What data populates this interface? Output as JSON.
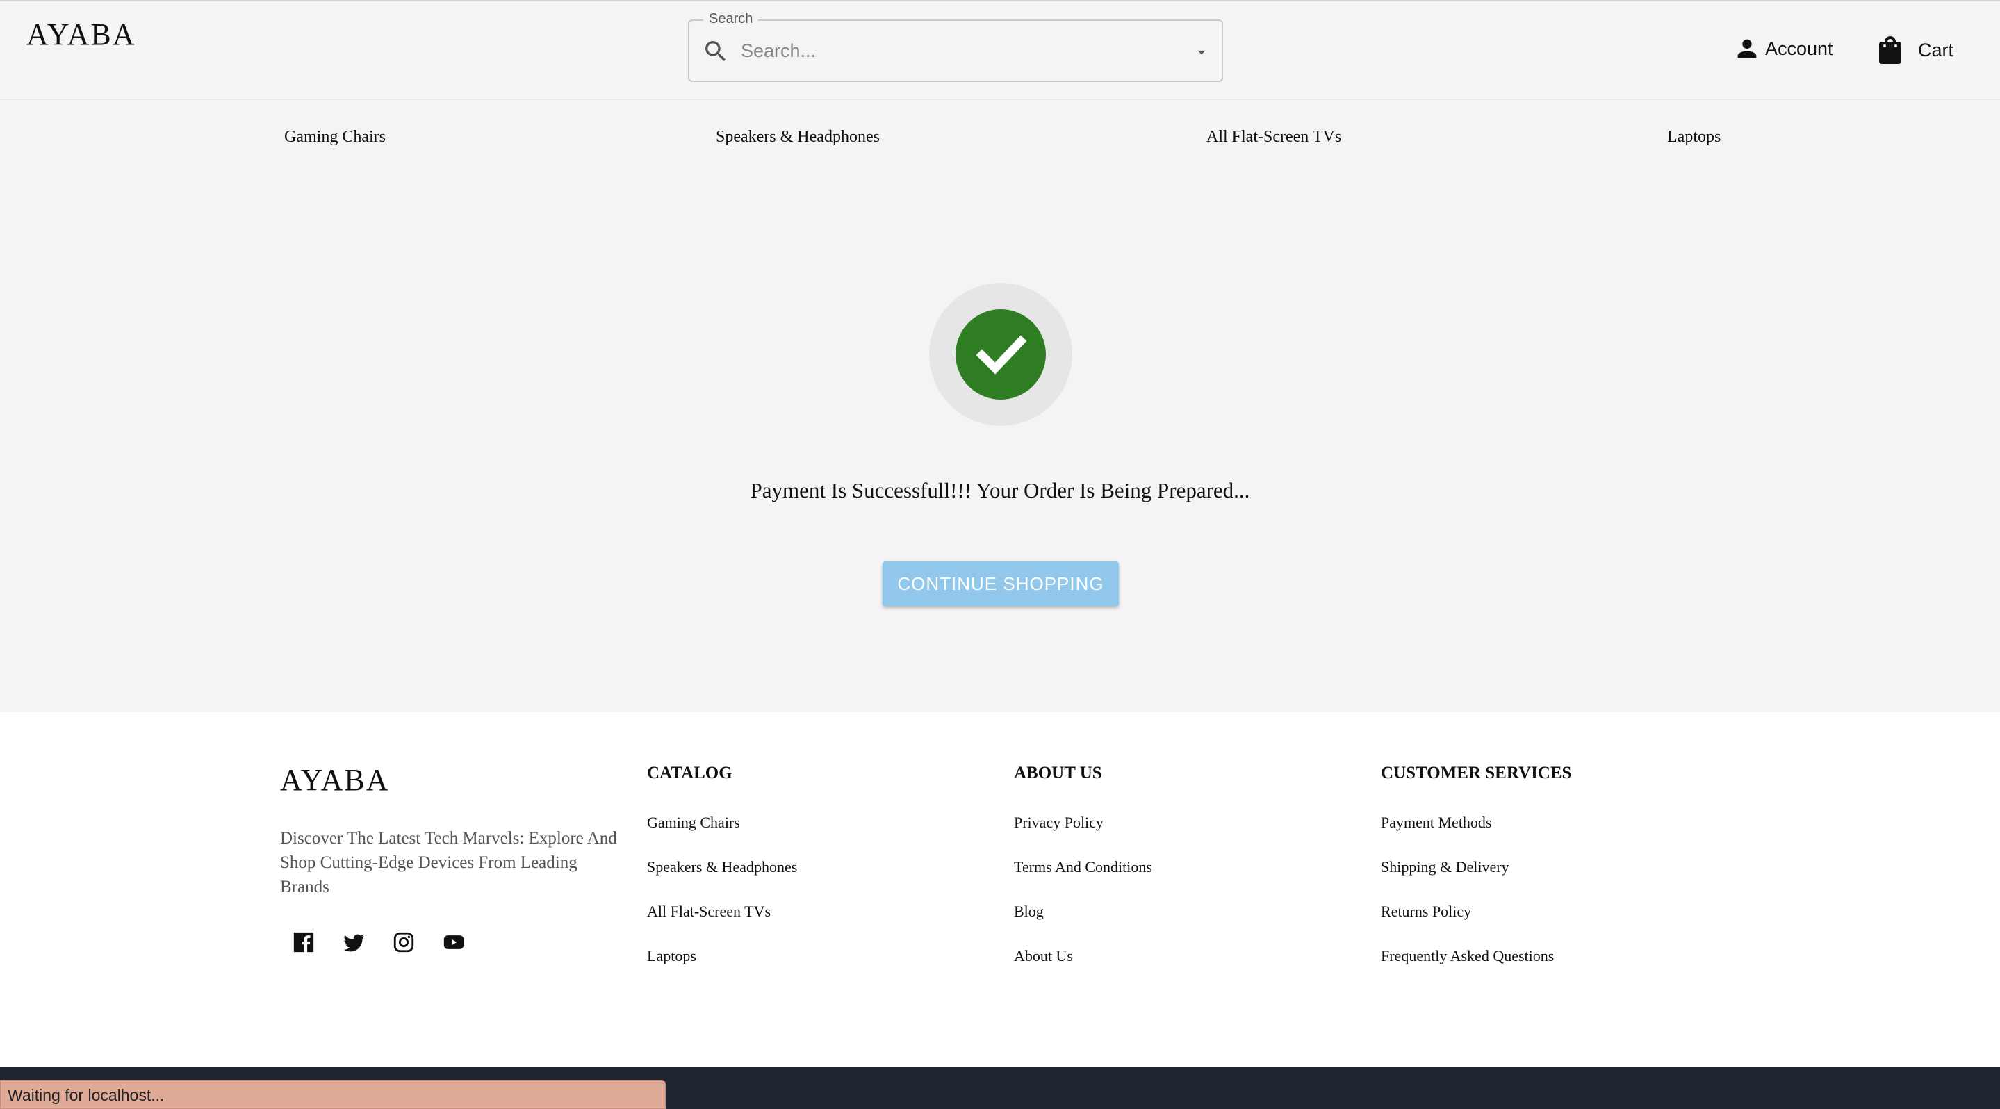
{
  "header": {
    "logo": "AYABA",
    "search_label": "Search",
    "search_placeholder": "Search...",
    "account_label": "Account",
    "cart_label": "Cart"
  },
  "categories": [
    "Gaming Chairs",
    "Speakers & Headphones",
    "All Flat-Screen TVs",
    "Laptops"
  ],
  "success": {
    "message": "Payment Is Successfull!!! Your Order Is Being Prepared...",
    "button_label": "CONTINUE SHOPPING",
    "accent_color": "#2e7d22",
    "button_color": "#90c7ea"
  },
  "footer": {
    "logo": "AYABA",
    "tagline": "Discover The Latest Tech Marvels: Explore And Shop Cutting-Edge Devices From Leading Brands",
    "socials": [
      "facebook-icon",
      "twitter-icon",
      "instagram-icon",
      "youtube-icon"
    ],
    "columns": [
      {
        "title": "CATALOG",
        "links": [
          "Gaming Chairs",
          "Speakers & Headphones",
          "All Flat-Screen TVs",
          "Laptops"
        ]
      },
      {
        "title": "ABOUT US",
        "links": [
          "Privacy Policy",
          "Terms And Conditions",
          "Blog",
          "About Us"
        ]
      },
      {
        "title": "CUSTOMER SERVICES",
        "links": [
          "Payment Methods",
          "Shipping & Delivery",
          "Returns Policy",
          "Frequently Asked Questions"
        ]
      }
    ]
  },
  "status_bar": {
    "text": "Waiting for localhost..."
  }
}
